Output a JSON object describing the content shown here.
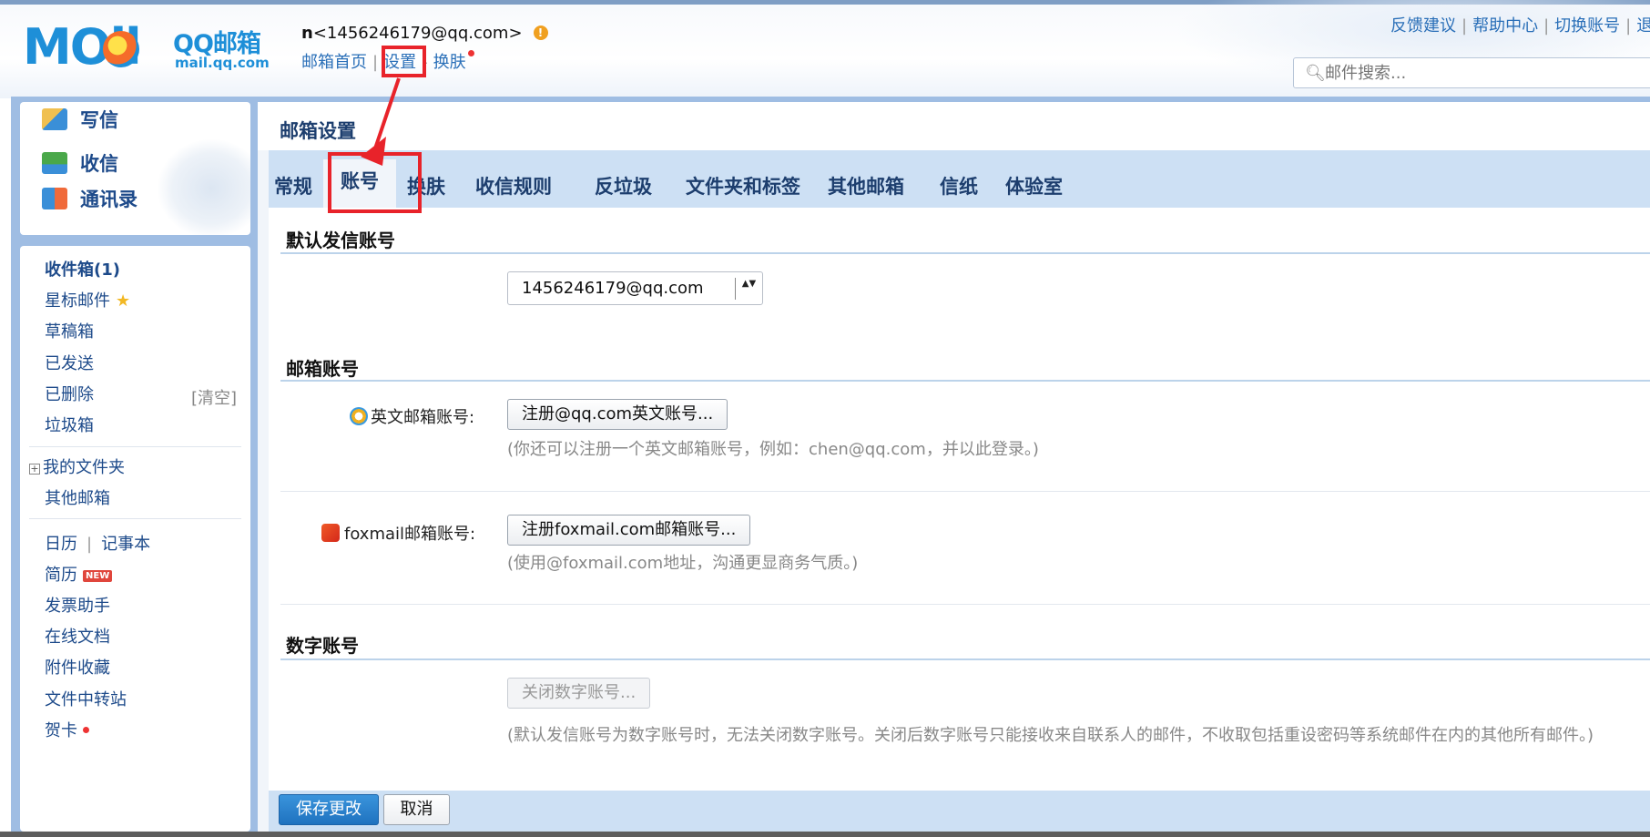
{
  "header": {
    "logo_mail": "MOil",
    "logo_brand": "QQ邮箱",
    "logo_domain": "mail.qq.com",
    "user_name": "n",
    "user_email": "<1456246179@qq.com>",
    "warn_glyph": "!",
    "nav": {
      "home": "邮箱首页",
      "settings": "设置",
      "skin": "换肤"
    },
    "sep": "|",
    "sep_dash": "-",
    "top_links": {
      "feedback": "反馈建议",
      "help": "帮助中心",
      "switch": "切换账号",
      "logout_partial": "退"
    },
    "search_placeholder": "邮件搜索..."
  },
  "quick": {
    "write": "写信",
    "receive": "收信",
    "contacts": "通讯录"
  },
  "folders": {
    "inbox": "收件箱(1)",
    "starred": "星标邮件",
    "star_glyph": "★",
    "drafts": "草稿箱",
    "sent": "已发送",
    "deleted": "已删除",
    "clear": "[清空]",
    "spam": "垃圾箱",
    "plus_glyph": "+",
    "my_folders": "我的文件夹",
    "other_mailbox": "其他邮箱",
    "calendar": "日历",
    "notes": "记事本",
    "resume": "简历",
    "new_tag": "NEW",
    "invoice": "发票助手",
    "docs": "在线文档",
    "attachments": "附件收藏",
    "transfer": "文件中转站",
    "cards": "贺卡"
  },
  "main": {
    "title": "邮箱设置",
    "tabs": [
      "常规",
      "账号",
      "换肤",
      "收信规则",
      "反垃圾",
      "文件夹和标签",
      "其他邮箱",
      "信纸",
      "体验室"
    ],
    "sections": {
      "default_sender": "默认发信账号",
      "mail_account": "邮箱账号",
      "digit_account": "数字账号"
    },
    "default_sender_value": "1456246179@qq.com",
    "select_arrows": "▲▼",
    "en_label": "英文邮箱账号:",
    "en_button": "注册@qq.com英文账号...",
    "en_hint": "(你还可以注册一个英文邮箱账号，例如：chen@qq.com，并以此登录。)",
    "fox_label": "foxmail邮箱账号:",
    "fox_button": "注册foxmail.com邮箱账号...",
    "fox_hint": "(使用@foxmail.com地址，沟通更显商务气质。)",
    "digit_button": "关闭数字账号...",
    "digit_hint": "(默认发信账号为数字账号时，无法关闭数字账号。关闭后数字账号只能接收来自联系人的邮件，不收取包括重设密码等系统邮件在内的其他所有邮件。)",
    "save": "保存更改",
    "cancel": "取消"
  },
  "colors": {
    "accent": "#1e8fd8",
    "annotation": "#e8232a",
    "frame": "#9fbde3",
    "tab_bar": "#cde0f4"
  }
}
